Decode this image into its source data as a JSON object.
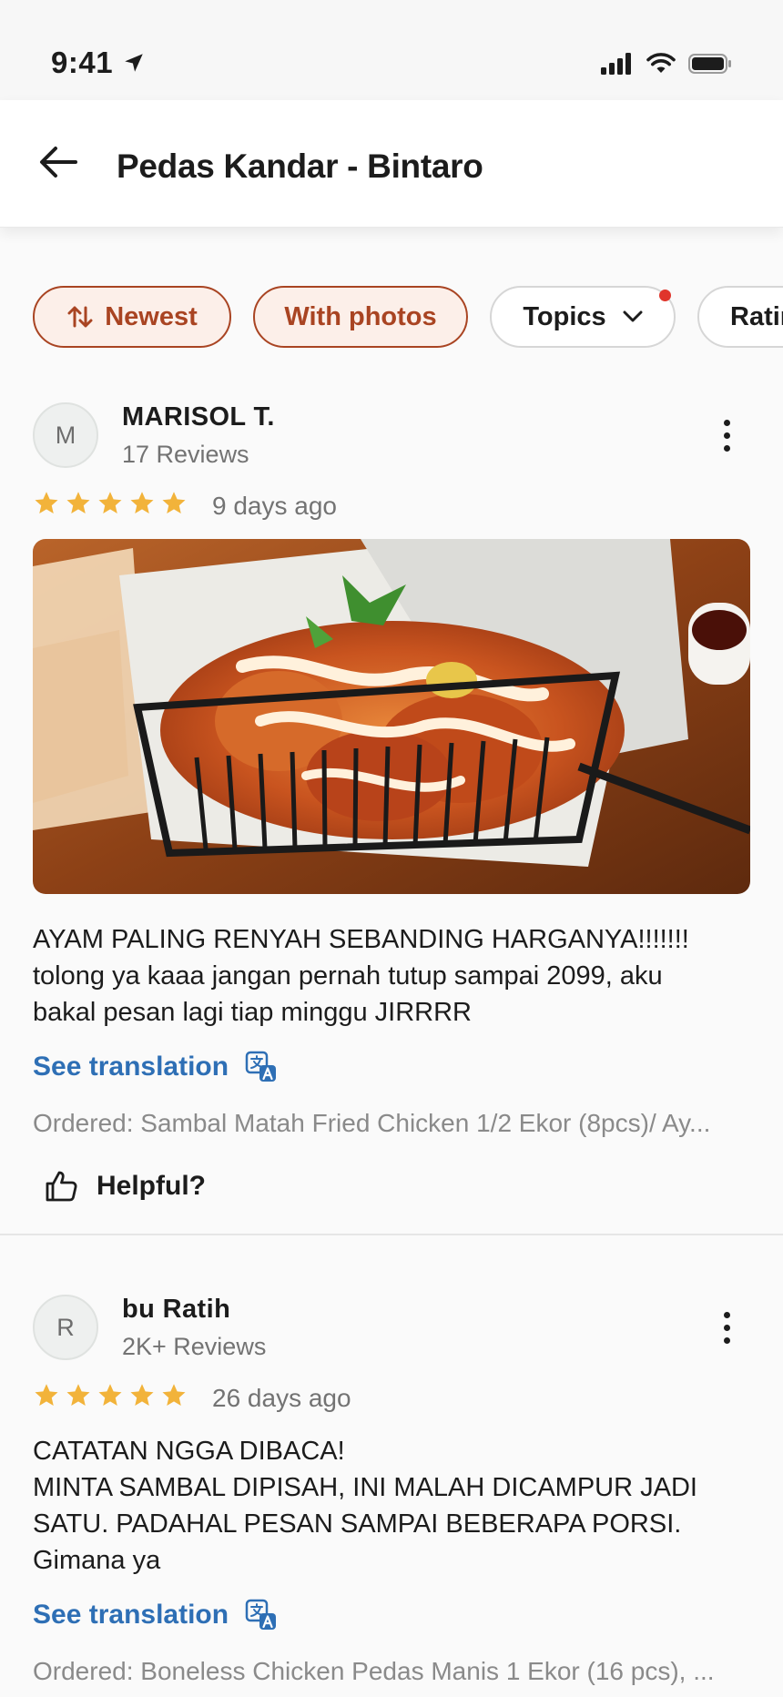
{
  "status_bar": {
    "time": "9:41"
  },
  "header": {
    "title": "Pedas Kandar - Bintaro"
  },
  "filters": [
    {
      "label": "Newest",
      "icon": "sort-icon",
      "active": true
    },
    {
      "label": "With photos",
      "active": true
    },
    {
      "label": "Topics",
      "icon": "chevron-down-icon",
      "active": false,
      "badge_color": "#e0352b"
    },
    {
      "label": "Ratin",
      "active": false
    }
  ],
  "reviews": [
    {
      "avatar_initial": "M",
      "name": "MARISOL T.",
      "review_count": "17 Reviews",
      "rating": 5,
      "date": "9 days ago",
      "has_photo": true,
      "text_lines": [
        "AYAM PALING RENYAH SEBANDING HARGANYA!!!!!!!",
        "tolong ya kaaa jangan pernah tutup sampai 2099, aku",
        "bakal pesan lagi tiap minggu JIRRRR"
      ],
      "see_translation": "See translation",
      "ordered": "Ordered: Sambal Matah Fried Chicken 1/2 Ekor (8pcs)/ Ay...",
      "helpful": "Helpful?"
    },
    {
      "avatar_initial": "R",
      "name": "bu Ratih",
      "review_count": "2K+ Reviews",
      "rating": 5,
      "date": "26 days ago",
      "has_photo": false,
      "text_lines": [
        "CATATAN NGGA DIBACA!",
        "MINTA SAMBAL DIPISAH, INI MALAH DICAMPUR JADI",
        "SATU. PADAHAL PESAN SAMPAI BEBERAPA PORSI.",
        "Gimana ya"
      ],
      "see_translation": "See translation",
      "ordered": "Ordered: Boneless Chicken Pedas Manis 1 Ekor (16 pcs), ..."
    }
  ],
  "colors": {
    "accent": "#a94422",
    "accent_bg": "#fcefe9",
    "link": "#2e6fb5",
    "star": "#f2b33a",
    "badge": "#e0352b"
  }
}
